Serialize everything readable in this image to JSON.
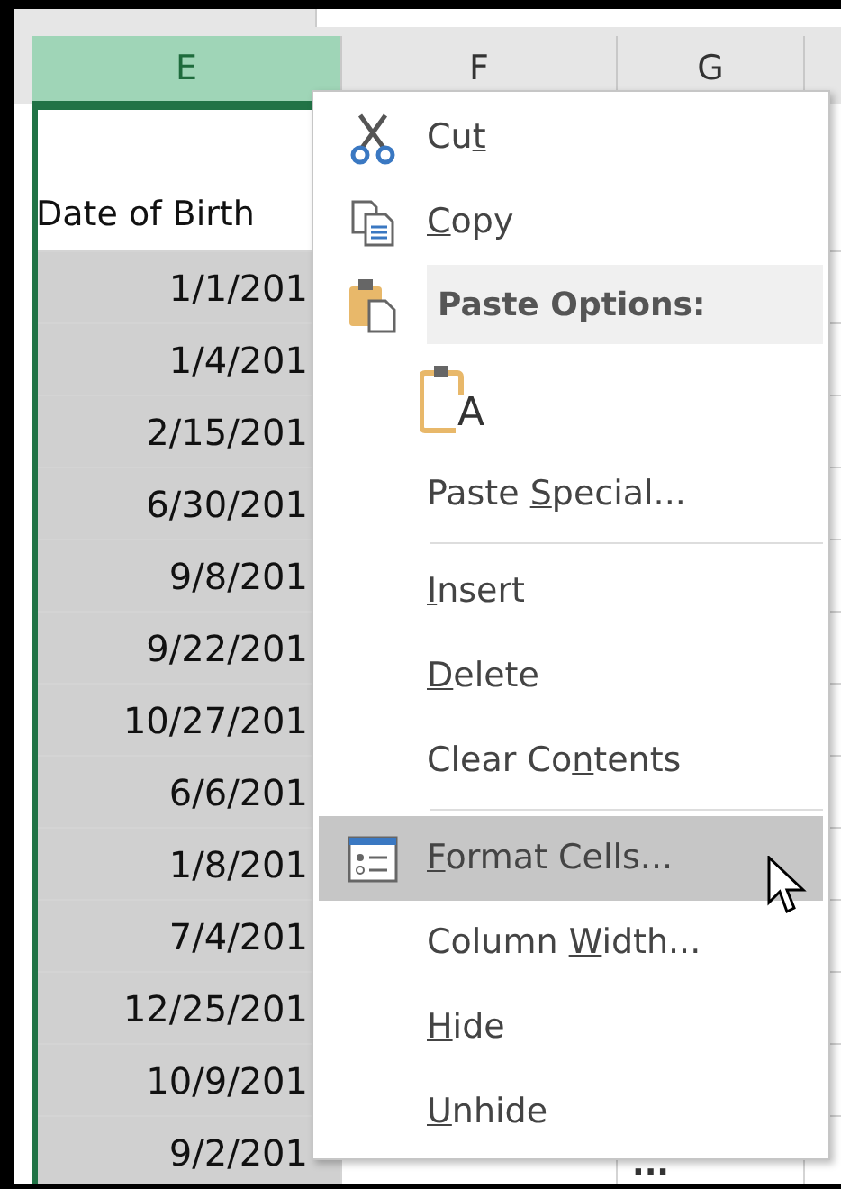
{
  "columns": [
    {
      "label": "E",
      "selected": true
    },
    {
      "label": "F",
      "selected": false
    },
    {
      "label": "G",
      "selected": false
    }
  ],
  "header_cell": "Date of Birth",
  "dates": [
    "1/1/201",
    "1/4/201",
    "2/15/201",
    "6/30/201",
    "9/8/201",
    "9/22/201",
    "10/27/201",
    "6/6/201",
    "1/8/201",
    "7/4/201",
    "12/25/201",
    "10/9/201",
    "9/2/201"
  ],
  "last_row_g": "...",
  "context_menu": [
    {
      "kind": "item",
      "label": {
        "before": "Cu",
        "key": "t"
      },
      "selected": false
    },
    {
      "kind": "item",
      "label": {
        "key": "C",
        "after": "opy"
      },
      "selected": false
    },
    {
      "kind": "header",
      "label": "Paste Options:"
    },
    {
      "kind": "paste-icons",
      "glyph": "A"
    },
    {
      "kind": "item",
      "label": {
        "before": "Paste ",
        "key": "S",
        "after": "pecial..."
      },
      "selected": false
    },
    {
      "kind": "separator"
    },
    {
      "kind": "item",
      "label": {
        "key": "I",
        "after": "nsert"
      },
      "selected": false
    },
    {
      "kind": "item",
      "label": {
        "key": "D",
        "after": "elete"
      },
      "selected": false
    },
    {
      "kind": "item",
      "label": {
        "before": "Clear Co",
        "key": "n",
        "after": "tents"
      },
      "selected": false
    },
    {
      "kind": "separator"
    },
    {
      "kind": "item",
      "label": {
        "key": "F",
        "after": "ormat Cells..."
      },
      "selected": true
    },
    {
      "kind": "item",
      "label": {
        "before": "Column ",
        "key": "W",
        "after": "idth..."
      },
      "selected": false
    },
    {
      "kind": "item",
      "label": {
        "key": "H",
        "after": "ide"
      },
      "selected": false
    },
    {
      "kind": "item",
      "label": {
        "key": "U",
        "after": "nhide"
      },
      "selected": false
    }
  ]
}
